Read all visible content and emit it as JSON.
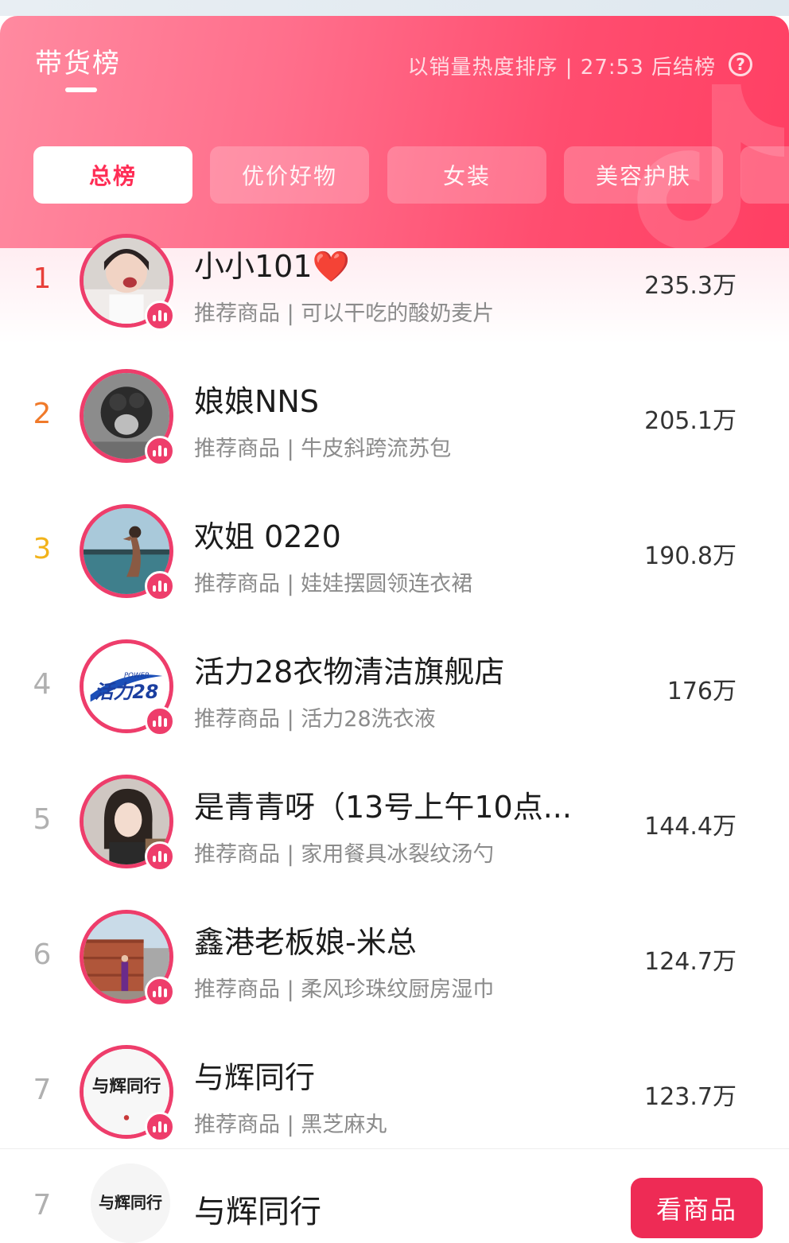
{
  "header": {
    "title": "带货榜",
    "status": "以销量热度排序 | 27:53 后结榜",
    "help_symbol": "?",
    "tabs": [
      {
        "label": "总榜",
        "active": true
      },
      {
        "label": "优价好物",
        "active": false
      },
      {
        "label": "女装",
        "active": false
      },
      {
        "label": "美容护肤",
        "active": false
      },
      {
        "label": "",
        "active": false
      }
    ]
  },
  "rank_colors": {
    "1": "#e8403a",
    "2": "#f07a2a",
    "3": "#f2b31a",
    "default": "#b0b0b0"
  },
  "rows": [
    {
      "rank": "1",
      "name": "小小101❤️",
      "subtitle": "推荐商品 | 可以干吃的酸奶麦片",
      "value": "235.3万",
      "avatar": "woman-smiling-avatar"
    },
    {
      "rank": "2",
      "name": "娘娘NNS",
      "subtitle": "推荐商品 | 牛皮斜跨流苏包",
      "value": "205.1万",
      "avatar": "grayscale-portrait-avatar"
    },
    {
      "rank": "3",
      "name": "欢姐 0220",
      "subtitle": "推荐商品 | 娃娃摆圆领连衣裙",
      "value": "190.8万",
      "avatar": "beach-photo-avatar"
    },
    {
      "rank": "4",
      "name": "活力28衣物清洁旗舰店",
      "subtitle": "推荐商品 | 活力28洗衣液",
      "value": "176万",
      "avatar": "brand-logo-avatar"
    },
    {
      "rank": "5",
      "name": "是青青呀（13号上午10点...",
      "subtitle": "推荐商品 | 家用餐具冰裂纹汤勺",
      "value": "144.4万",
      "avatar": "woman-portrait-avatar"
    },
    {
      "rank": "6",
      "name": "鑫港老板娘-米总",
      "subtitle": "推荐商品 | 柔风珍珠纹厨房湿巾",
      "value": "124.7万",
      "avatar": "container-yard-avatar"
    },
    {
      "rank": "7",
      "name": "与辉同行",
      "subtitle": "推荐商品 | 黑芝麻丸",
      "value": "123.7万",
      "avatar": "calligraphy-logo-avatar"
    }
  ],
  "avatar_logo_texts": {
    "brand": "活力28",
    "brand_power": "POWER",
    "calligraphy": "与辉同行"
  },
  "bottom_bar": {
    "rank": "7",
    "name": "与辉同行",
    "button_label": "看商品"
  }
}
